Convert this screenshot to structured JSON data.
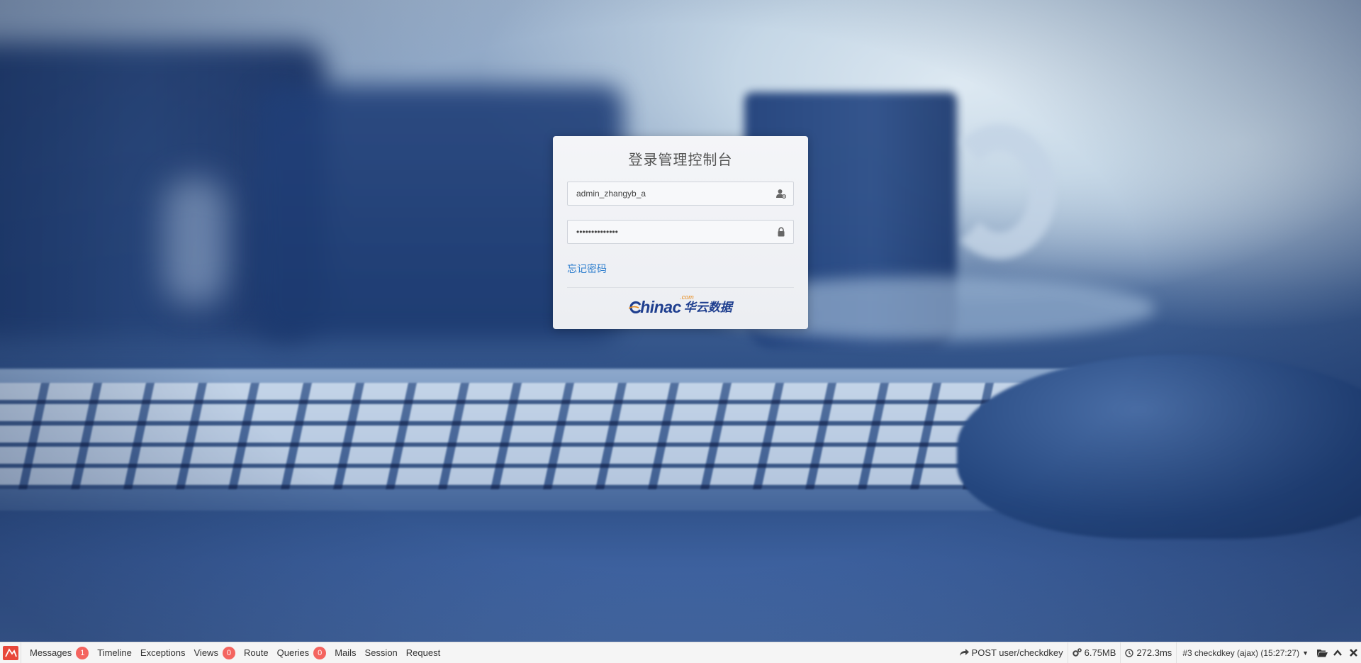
{
  "login": {
    "title": "登录管理控制台",
    "username_value": "admin_zhangyb_a",
    "password_value": "••••••••••••••",
    "forgot_label": "忘记密码",
    "icons": {
      "user": "user-gear-icon",
      "password": "lock-icon"
    }
  },
  "brand": {
    "logo_text": "hinac",
    "logo_cn": "华云数据",
    "logo_com": ".com",
    "colors": {
      "primary": "#1f3f8f",
      "accent": "#e88a1a"
    }
  },
  "debugbar": {
    "tabs": [
      {
        "label": "Messages",
        "badge": "1"
      },
      {
        "label": "Timeline"
      },
      {
        "label": "Exceptions"
      },
      {
        "label": "Views",
        "badge": "0"
      },
      {
        "label": "Route"
      },
      {
        "label": "Queries",
        "badge": "0"
      },
      {
        "label": "Mails"
      },
      {
        "label": "Session"
      },
      {
        "label": "Request"
      }
    ],
    "request_label": "POST user/checkdkey",
    "memory": "6.75MB",
    "time": "272.3ms",
    "request_select": "#3 checkdkey (ajax) (15:27:27)",
    "colors": {
      "badge": "#f4645f",
      "logo": "#e8473a"
    }
  }
}
